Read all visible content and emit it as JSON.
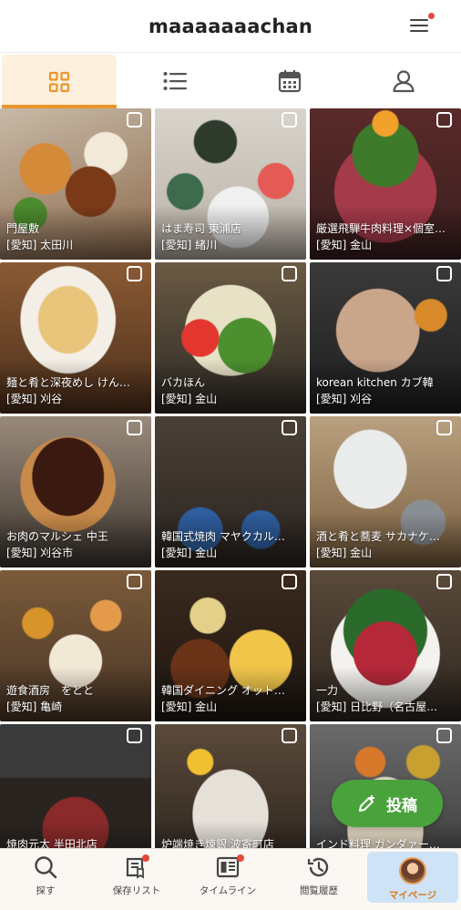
{
  "header": {
    "title": "maaaaaaachan"
  },
  "tabs": [
    {
      "icon": "grid-icon",
      "active": true
    },
    {
      "icon": "list-icon",
      "active": false
    },
    {
      "icon": "calendar-icon",
      "active": false
    },
    {
      "icon": "profile-icon",
      "active": false
    }
  ],
  "posts": [
    {
      "name": "門屋敷",
      "loc": "[愛知] 太田川"
    },
    {
      "name": "はま寿司 東浦店",
      "loc": "[愛知] 緒川"
    },
    {
      "name": "厳選飛騨牛肉料理×個室…",
      "loc": "[愛知] 金山"
    },
    {
      "name": "麺と肴と深夜めし けん…",
      "loc": "[愛知] 刈谷"
    },
    {
      "name": "バカほん",
      "loc": "[愛知] 金山"
    },
    {
      "name": "korean kitchen カブ韓",
      "loc": "[愛知] 刈谷"
    },
    {
      "name": "お肉のマルシェ 中王",
      "loc": "[愛知] 刈谷市"
    },
    {
      "name": "韓国式焼肉 マヤクカル…",
      "loc": "[愛知] 金山"
    },
    {
      "name": "酒と肴と蕎麦 サカナケ…",
      "loc": "[愛知] 金山"
    },
    {
      "name": "遊食酒房　をとと",
      "loc": "[愛知] 亀崎"
    },
    {
      "name": "韓国ダイニング オット…",
      "loc": "[愛知] 金山"
    },
    {
      "name": "一力",
      "loc": "[愛知] 日比野（名古屋…"
    },
    {
      "name": "焼肉元太 半田北店",
      "loc": ""
    },
    {
      "name": "炉端焼き煉銀 波寄町店",
      "loc": ""
    },
    {
      "name": "インド料理 ガンダァー…",
      "loc": ""
    }
  ],
  "fab": {
    "label": "投稿",
    "color": "#4aa23c"
  },
  "bottom_nav": [
    {
      "label": "探す",
      "icon": "search-icon"
    },
    {
      "label": "保存リスト",
      "icon": "saved-list-icon"
    },
    {
      "label": "タイムライン",
      "icon": "timeline-icon"
    },
    {
      "label": "閲覧履歴",
      "icon": "history-icon"
    },
    {
      "label": "マイページ",
      "icon": "avatar"
    }
  ],
  "colors": {
    "accent": "#e9952e",
    "active_tab_bg": "#fdf0dc",
    "badge": "#e5483f",
    "mypage_active_bg": "#cfe3f6"
  }
}
